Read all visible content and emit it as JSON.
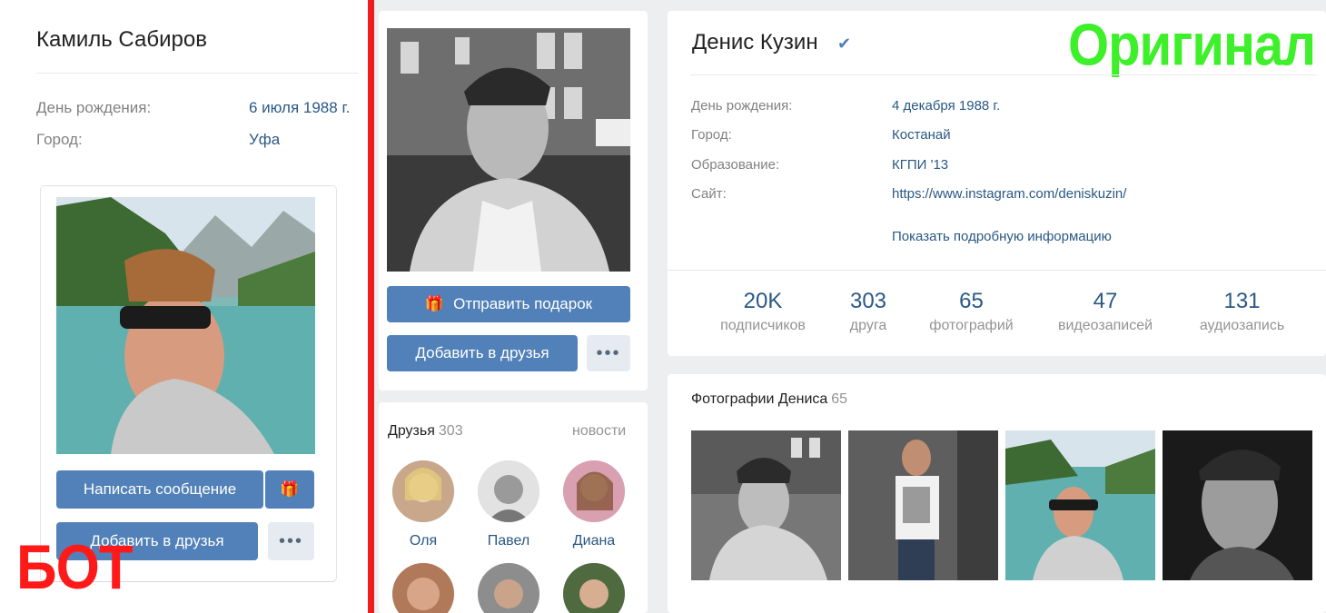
{
  "bot": {
    "name": "Камиль Сабиров",
    "birthday_label": "День рождения:",
    "birthday_value": "6 июля 1988 г.",
    "city_label": "Город:",
    "city_value": "Уфа",
    "message_button": "Написать сообщение",
    "add_friend_button": "Добавить в друзья",
    "more_button": "•••",
    "label": "БОТ"
  },
  "original": {
    "label": "Оригинал",
    "name": "Денис Кузин",
    "verified_icon": "✔",
    "gift_button": "Отправить подарок",
    "add_friend_button": "Добавить в друзья",
    "more_button": "•••",
    "fields": [
      {
        "label": "День рождения:",
        "value": "4 декабря 1988 г."
      },
      {
        "label": "Город:",
        "value": "Костанай"
      },
      {
        "label": "Образование:",
        "value": "КГПИ '13"
      },
      {
        "label": "Сайт:",
        "value": "https://www.instagram.com/deniskuzin/"
      }
    ],
    "show_more": "Показать подробную информацию",
    "counters": [
      {
        "num": "20K",
        "cap": "подписчиков"
      },
      {
        "num": "303",
        "cap": "друга"
      },
      {
        "num": "65",
        "cap": "фотографий"
      },
      {
        "num": "47",
        "cap": "видеозаписей"
      },
      {
        "num": "131",
        "cap": "аудиозапись"
      }
    ],
    "friends": {
      "title": "Друзья",
      "count": "303",
      "news": "новости",
      "items": [
        "Оля",
        "Павел",
        "Диана"
      ]
    },
    "photos": {
      "title": "Фотографии Дениса",
      "count": "65"
    }
  },
  "colors": {
    "accent": "#5181b8",
    "link": "#2a5885",
    "bot_label": "#ff1a1a",
    "orig_label": "#3ef02a",
    "divider": "#ee1c1c"
  }
}
